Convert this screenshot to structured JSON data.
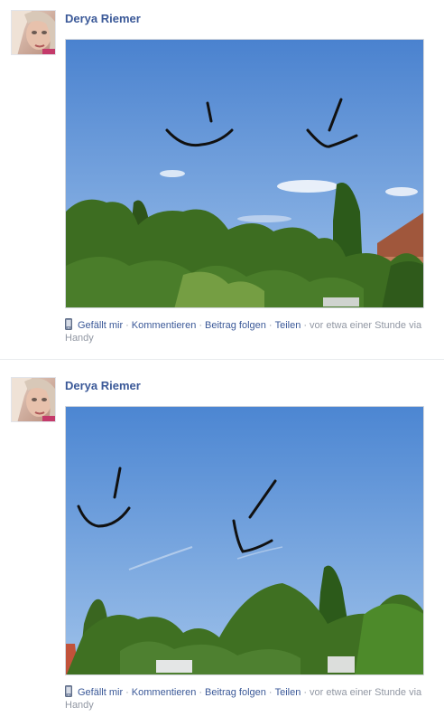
{
  "posts": [
    {
      "author": "Derya Riemer",
      "actions": {
        "like": "Gefällt mir",
        "comment": "Kommentieren",
        "follow": "Beitrag folgen",
        "share": "Teilen"
      },
      "timestamp": "vor etwa einer Stunde via",
      "via": "Handy"
    },
    {
      "author": "Derya Riemer",
      "actions": {
        "like": "Gefällt mir",
        "comment": "Kommentieren",
        "follow": "Beitrag folgen",
        "share": "Teilen"
      },
      "timestamp": "vor etwa einer Stunde via",
      "via": "Handy"
    }
  ],
  "separator": "·",
  "icons": {
    "device": "mobile-phone-icon"
  },
  "colors": {
    "author": "#3b5998",
    "link": "#3b5998",
    "meta": "#9197a3",
    "sky": "#5e93d6",
    "foliage": "#3a6b1e"
  }
}
